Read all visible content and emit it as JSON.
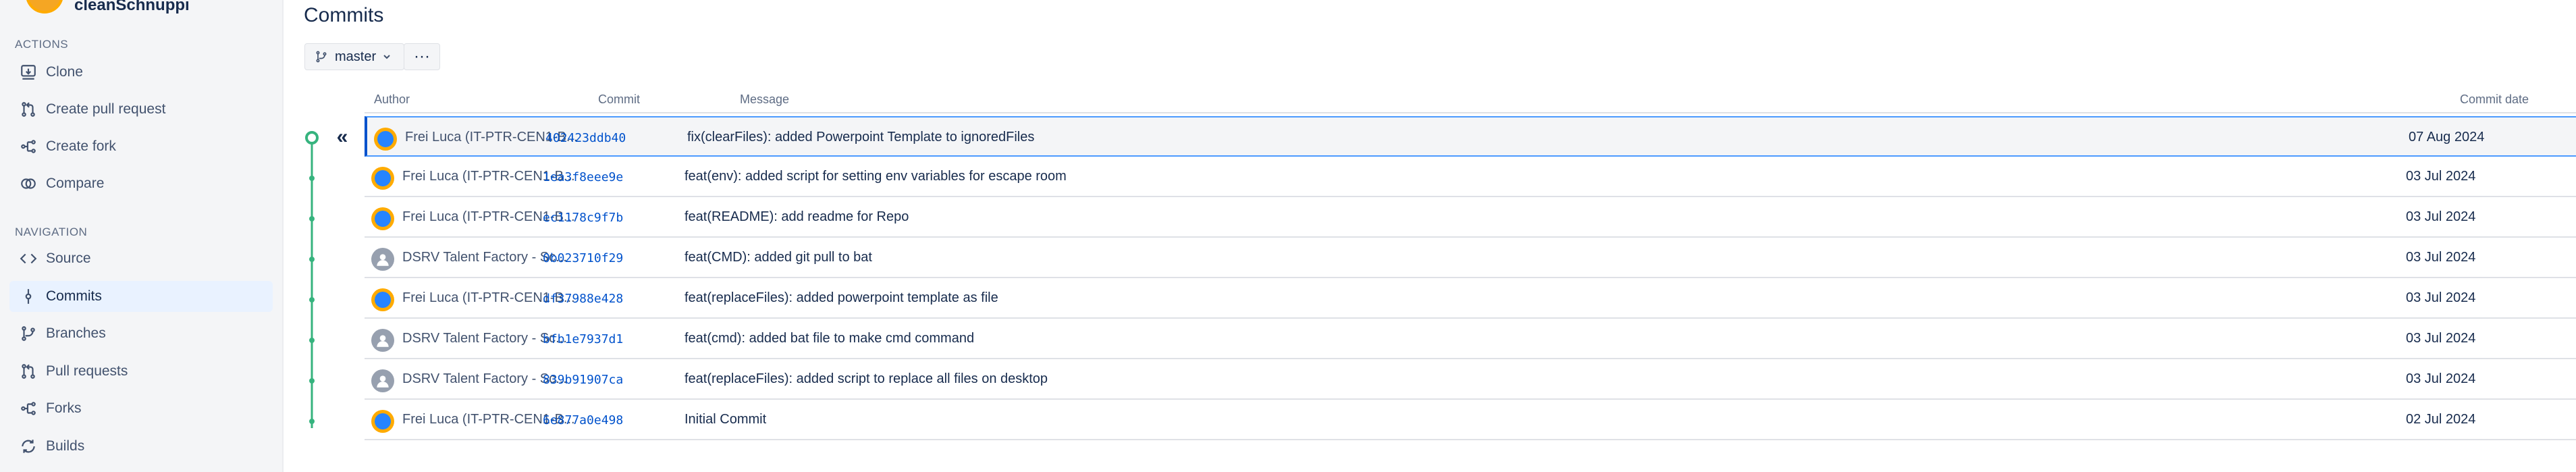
{
  "repo": {
    "name": "cleanSchnuppi"
  },
  "sidebar": {
    "actions_heading": "ACTIONS",
    "actions": [
      {
        "label": "Clone",
        "icon": "clone-icon"
      },
      {
        "label": "Create pull request",
        "icon": "pull-request-icon"
      },
      {
        "label": "Create fork",
        "icon": "fork-icon"
      },
      {
        "label": "Compare",
        "icon": "compare-icon"
      }
    ],
    "navigation_heading": "NAVIGATION",
    "navigation": [
      {
        "label": "Source",
        "icon": "code-icon"
      },
      {
        "label": "Commits",
        "icon": "commit-icon",
        "active": true
      },
      {
        "label": "Branches",
        "icon": "branch-icon"
      },
      {
        "label": "Pull requests",
        "icon": "pull-request-icon"
      },
      {
        "label": "Forks",
        "icon": "fork-icon"
      },
      {
        "label": "Builds",
        "icon": "builds-icon"
      }
    ]
  },
  "page": {
    "title": "Commits",
    "branch": "master",
    "more_label": "···",
    "collapse_label": "«"
  },
  "table": {
    "headers": {
      "author": "Author",
      "commit": "Commit",
      "message": "Message",
      "date": "Commit date"
    },
    "rows": [
      {
        "author": "Frei Luca (IT-PTR-CEN1-B...",
        "avatar": "user",
        "hash": "402423ddb40",
        "message": "fix(clearFiles): added Powerpoint Template to ignoredFiles",
        "date": "07 Aug 2024"
      },
      {
        "author": "Frei Luca (IT-PTR-CEN1-B...",
        "avatar": "user",
        "hash": "1ea3f8eee9e",
        "message": "feat(env): added script for setting env variables for escape room",
        "date": "03 Jul 2024"
      },
      {
        "author": "Frei Luca (IT-PTR-CEN1-B...",
        "avatar": "user",
        "hash": "ec1178c9f7b",
        "message": "feat(README): add readme for Repo",
        "date": "03 Jul 2024"
      },
      {
        "author": "DSRV Talent Factory - Sc...",
        "avatar": "default",
        "hash": "0b023710f29",
        "message": "feat(CMD): added git pull to bat",
        "date": "03 Jul 2024"
      },
      {
        "author": "Frei Luca (IT-PTR-CEN1-B...",
        "avatar": "user",
        "hash": "df37988e428",
        "message": "feat(replaceFiles): added powerpoint template as file",
        "date": "03 Jul 2024"
      },
      {
        "author": "DSRV Talent Factory - Sc...",
        "avatar": "default",
        "hash": "bfb1e7937d1",
        "message": "feat(cmd): added bat file to make cmd command",
        "date": "03 Jul 2024"
      },
      {
        "author": "DSRV Talent Factory - Sc...",
        "avatar": "default",
        "hash": "839b91907ca",
        "message": "feat(replaceFiles): added script to replace all files on desktop",
        "date": "03 Jul 2024"
      },
      {
        "author": "Frei Luca (IT-PTR-CEN1-B...",
        "avatar": "user",
        "hash": "6e877a0e498",
        "message": "Initial Commit",
        "date": "02 Jul 2024"
      }
    ]
  },
  "colors": {
    "graph": "#36b37e",
    "link": "#0052cc",
    "active_nav": "#e9f2ff"
  }
}
